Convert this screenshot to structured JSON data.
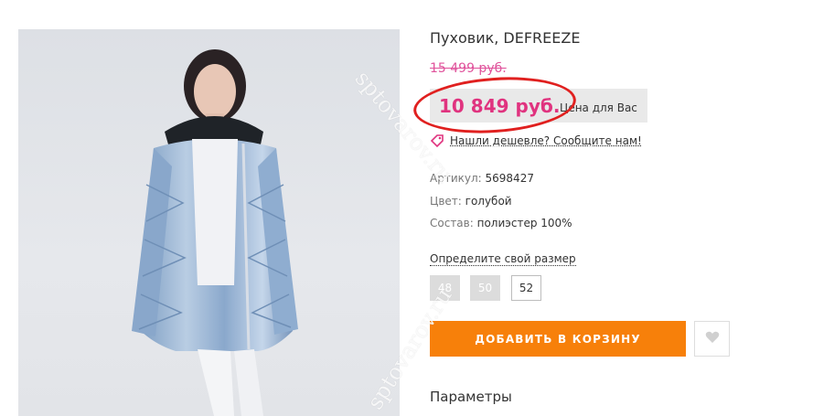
{
  "product": {
    "title": "Пуховик, DEFREEZE",
    "old_price": "15 499 руб.",
    "new_price": "10 849 руб.",
    "price_note": "Цена для Вас",
    "cheaper_link": "Нашли дешевле? Сообщите нам!"
  },
  "attributes": [
    {
      "label": "Артикул:",
      "value": "5698427"
    },
    {
      "label": "Цвет:",
      "value": "голубой"
    },
    {
      "label": "Состав:",
      "value": "полиэстер 100%"
    }
  ],
  "sizes": {
    "link": "Определите свой размер",
    "options": [
      {
        "label": "48",
        "available": false
      },
      {
        "label": "50",
        "available": false
      },
      {
        "label": "52",
        "available": true
      }
    ]
  },
  "actions": {
    "add_to_cart": "ДОБАВИТЬ В КОРЗИНУ",
    "wishlist_icon": "heart-icon"
  },
  "sections": {
    "params": "Параметры"
  },
  "watermark": {
    "text1": "sptovarov.ru",
    "text2": "sptovarov.ru"
  },
  "colors": {
    "price": "#e0337f",
    "old_price": "#e0529b",
    "cart_button": "#f7800a",
    "annotation_circle": "#e0201f"
  }
}
